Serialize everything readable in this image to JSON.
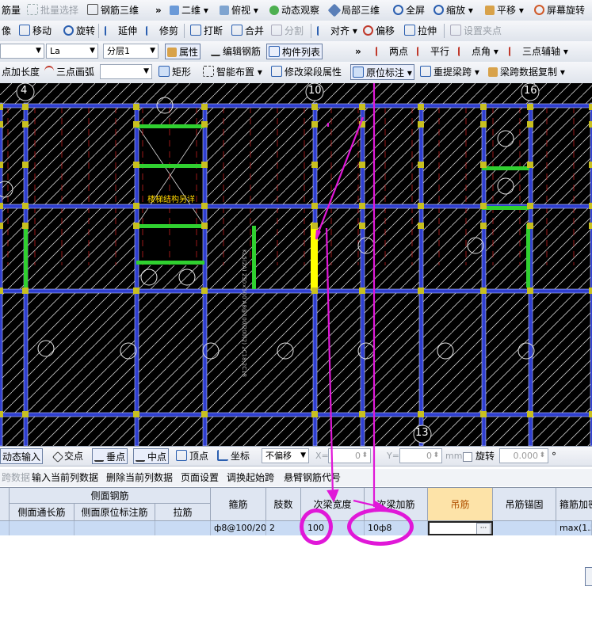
{
  "toolbar1": {
    "items": [
      "筋量",
      "批量选择",
      "钢筋三维",
      "»",
      "二维",
      "俯视",
      "动态观察",
      "局部三维",
      "全屏",
      "缩放",
      "平移",
      "屏幕旋转"
    ]
  },
  "toolbar2": {
    "items": [
      "像",
      "移动",
      "旋转",
      "延伸",
      "修剪",
      "打断",
      "合并",
      "分割",
      "对齐",
      "偏移",
      "拉伸",
      "设置夹点"
    ]
  },
  "toolbar3": {
    "select1": "",
    "select2": "La",
    "select3": "分层1",
    "items": [
      "属性",
      "编辑钢筋",
      "构件列表",
      "»",
      "两点",
      "平行",
      "点角",
      "三点辅轴"
    ]
  },
  "toolbar4": {
    "items": [
      "点加长度",
      "三点画弧",
      "矩形",
      "智能布置",
      "修改梁段属性",
      "原位标注",
      "重提梁跨",
      "梁跨数据复制"
    ]
  },
  "canvas": {
    "axis_labels": [
      "4",
      "10",
      "16",
      "13"
    ],
    "stair_text": "楼梯结构另详",
    "beam_text": "KL5(2A) 250×500 A8@100/200(2) 2C18;2C18"
  },
  "snapbar": {
    "items": [
      "动态输入",
      "交点",
      "垂点",
      "中点",
      "顶点",
      "坐标"
    ],
    "offset_mode": "不偏移",
    "x_label": "X=",
    "x_value": "0",
    "y_label": "Y=",
    "y_value": "0",
    "unit": "mm",
    "rotate_label": "旋转",
    "rotate_value": "0.000",
    "degree": "°"
  },
  "menu2": {
    "items": [
      "跨数据",
      "输入当前列数据",
      "删除当前列数据",
      "页面设置",
      "调换起始跨",
      "悬臂钢筋代号"
    ]
  },
  "grid": {
    "group_header": "侧面钢筋",
    "headers": [
      "侧面通长筋",
      "侧面原位标注筋",
      "拉筋",
      "箍筋",
      "肢数",
      "次梁宽度",
      "次梁加筋",
      "吊筋",
      "吊筋锚固",
      "箍筋加密"
    ],
    "row": [
      "",
      "",
      "",
      "ф8@100/20",
      "2",
      "100",
      "10ф8",
      "",
      "",
      "max(1.5"
    ]
  },
  "colors": {
    "highlight_column": "#fde3a8",
    "annotation": "#e018d8",
    "beam_selected": "#ffff00"
  }
}
